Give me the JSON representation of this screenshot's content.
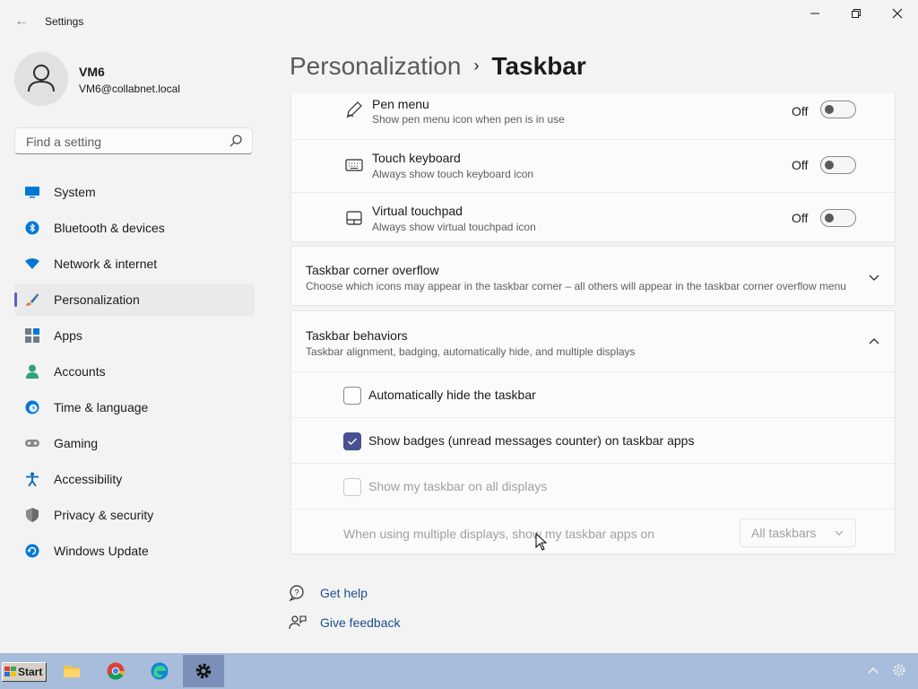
{
  "window": {
    "title": "Settings"
  },
  "user": {
    "name": "VM6",
    "email": "VM6@collabnet.local"
  },
  "search": {
    "placeholder": "Find a setting"
  },
  "nav": [
    {
      "label": "System",
      "icon": "monitor-icon",
      "color": "#0078d4"
    },
    {
      "label": "Bluetooth & devices",
      "icon": "bluetooth-icon",
      "color": "#0078d4"
    },
    {
      "label": "Network & internet",
      "icon": "wifi-icon",
      "color": "#0078d4"
    },
    {
      "label": "Personalization",
      "icon": "brush-icon",
      "color": "#e07b39",
      "active": true
    },
    {
      "label": "Apps",
      "icon": "apps-icon",
      "color": "#6b7b8c"
    },
    {
      "label": "Accounts",
      "icon": "person-icon",
      "color": "#2fa37a"
    },
    {
      "label": "Time & language",
      "icon": "globe-clock-icon",
      "color": "#0078d4"
    },
    {
      "label": "Gaming",
      "icon": "gamepad-icon",
      "color": "#8a8a8a"
    },
    {
      "label": "Accessibility",
      "icon": "accessibility-icon",
      "color": "#0067c0"
    },
    {
      "label": "Privacy & security",
      "icon": "shield-icon",
      "color": "#7a7a7a"
    },
    {
      "label": "Windows Update",
      "icon": "update-icon",
      "color": "#0078d4"
    }
  ],
  "breadcrumb": {
    "parent": "Personalization",
    "separator": "›",
    "current": "Taskbar"
  },
  "corner_icons": [
    {
      "title": "Pen menu",
      "subtitle": "Show pen menu icon when pen is in use",
      "state": "Off",
      "icon": "pen-icon"
    },
    {
      "title": "Touch keyboard",
      "subtitle": "Always show touch keyboard icon",
      "state": "Off",
      "icon": "keyboard-icon"
    },
    {
      "title": "Virtual touchpad",
      "subtitle": "Always show virtual touchpad icon",
      "state": "Off",
      "icon": "touchpad-icon"
    }
  ],
  "corner_overflow": {
    "title": "Taskbar corner overflow",
    "subtitle": "Choose which icons may appear in the taskbar corner – all others will appear in the taskbar corner overflow menu"
  },
  "behaviors": {
    "title": "Taskbar behaviors",
    "subtitle": "Taskbar alignment, badging, automatically hide, and multiple displays",
    "auto_hide": {
      "label": "Automatically hide the taskbar",
      "checked": false
    },
    "badges": {
      "label": "Show badges (unread messages counter) on taskbar apps",
      "checked": true
    },
    "all_displays": {
      "label": "Show my taskbar on all displays",
      "checked": false,
      "disabled": true
    },
    "multi_display": {
      "label": "When using multiple displays, show my taskbar apps on",
      "value": "All taskbars"
    }
  },
  "help": {
    "get_help": "Get help",
    "feedback": "Give feedback"
  },
  "taskbar": {
    "start_label": "Start",
    "apps": [
      "file-explorer-icon",
      "chrome-icon",
      "edge-icon",
      "settings-gear-icon"
    ],
    "accent": "#a8bddc"
  },
  "colors": {
    "accent": "#4a4f8f",
    "link": "#1b4f8e"
  }
}
